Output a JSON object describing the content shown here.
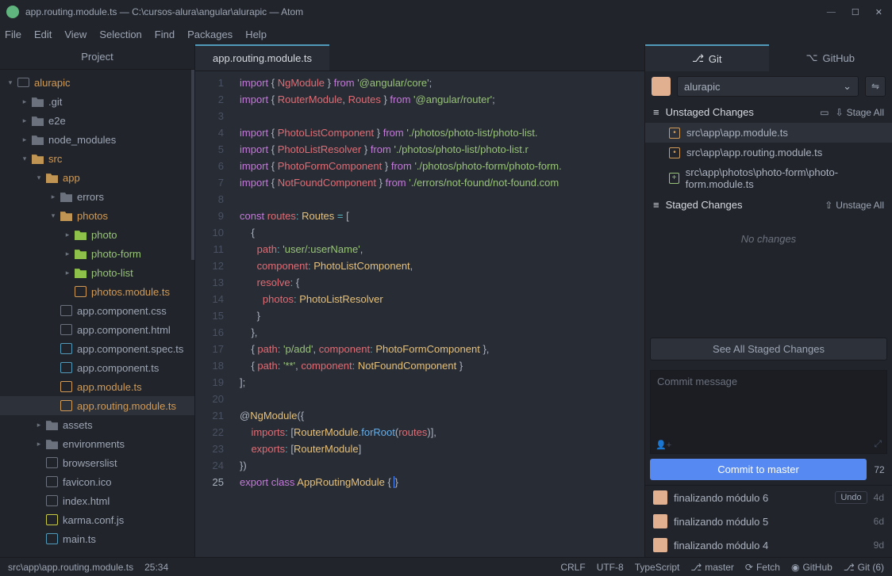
{
  "titlebar": {
    "text": "app.routing.module.ts — C:\\cursos-alura\\angular\\alurapic — Atom"
  },
  "winctl": {
    "min": "—",
    "max": "☐",
    "close": "✕"
  },
  "menu": {
    "file": "File",
    "edit": "Edit",
    "view": "View",
    "selection": "Selection",
    "find": "Find",
    "packages": "Packages",
    "help": "Help"
  },
  "sidebar": {
    "header": "Project",
    "root": "alurapic",
    "items": {
      "git": ".git",
      "e2e": "e2e",
      "node_modules": "node_modules",
      "src": "src",
      "app": "app",
      "errors": "errors",
      "photos": "photos",
      "photo": "photo",
      "photo_form": "photo-form",
      "photo_list": "photo-list",
      "photos_module": "photos.module.ts",
      "app_component_css": "app.component.css",
      "app_component_html": "app.component.html",
      "app_component_spec": "app.component.spec.ts",
      "app_component_ts": "app.component.ts",
      "app_module_ts": "app.module.ts",
      "app_routing_module_ts": "app.routing.module.ts",
      "assets": "assets",
      "environments": "environments",
      "browserslist": "browserslist",
      "favicon": "favicon.ico",
      "index_html": "index.html",
      "karma": "karma.conf.js",
      "main_ts": "main.ts"
    }
  },
  "tab": {
    "name": "app.routing.module.ts"
  },
  "gutter": [
    "1",
    "2",
    "3",
    "4",
    "5",
    "6",
    "7",
    "8",
    "9",
    "10",
    "11",
    "12",
    "13",
    "14",
    "15",
    "16",
    "17",
    "18",
    "19",
    "20",
    "21",
    "22",
    "23",
    "24",
    "25"
  ],
  "git": {
    "tab_git": "Git",
    "tab_github": "GitHub",
    "branch": "alurapic",
    "unstaged": "Unstaged Changes",
    "stage_all": "Stage All",
    "changes": {
      "c1": "src\\app\\app.module.ts",
      "c2": "src\\app\\app.routing.module.ts",
      "c3": "src\\app\\photos\\photo-form\\photo-form.module.ts"
    },
    "staged": "Staged Changes",
    "unstage_all": "Unstage All",
    "no_changes": "No changes",
    "see_all": "See All Staged Changes",
    "commit_placeholder": "Commit message",
    "commit_btn": "Commit to master",
    "count": "72",
    "history": {
      "h1": {
        "msg": "finalizando módulo 6",
        "time": "4d",
        "undo": "Undo"
      },
      "h2": {
        "msg": "finalizando módulo 5",
        "time": "6d"
      },
      "h3": {
        "msg": "finalizando módulo 4",
        "time": "9d"
      }
    }
  },
  "status": {
    "path": "src\\app\\app.routing.module.ts",
    "cursor": "25:34",
    "crlf": "CRLF",
    "enc": "UTF-8",
    "lang": "TypeScript",
    "branch": "master",
    "fetch": "Fetch",
    "github": "GitHub",
    "gitcount": "Git (6)"
  }
}
